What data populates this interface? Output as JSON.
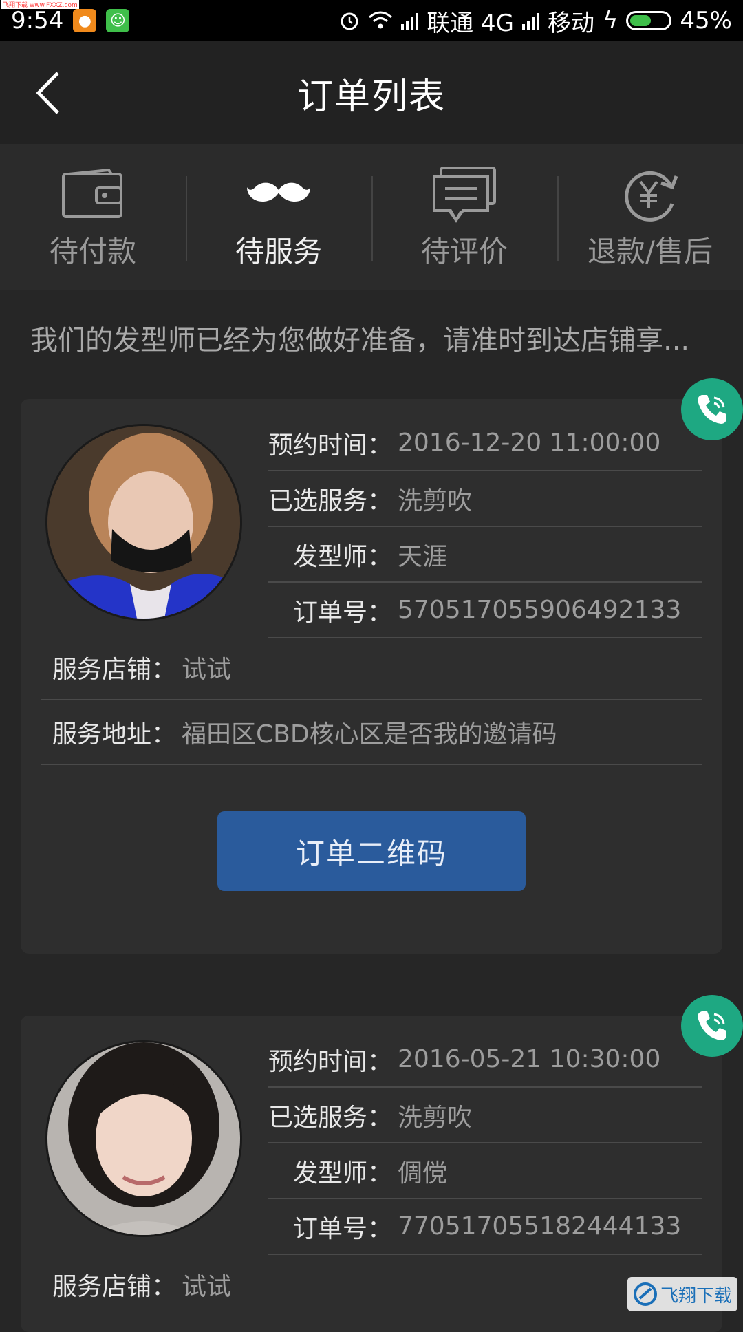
{
  "status_bar": {
    "time": "9:54",
    "carrier1": "联通 4G",
    "carrier2": "移动",
    "battery": "45%",
    "battery_level": 0.45,
    "top_watermark": "飞翔下载 www.FXXZ.com"
  },
  "header": {
    "title": "订单列表"
  },
  "tabs": [
    {
      "label": "待付款",
      "icon": "wallet-icon",
      "active": false
    },
    {
      "label": "待服务",
      "icon": "mustache-icon",
      "active": true
    },
    {
      "label": "待评价",
      "icon": "chat-icon",
      "active": false
    },
    {
      "label": "退款/售后",
      "icon": "yuan-refund-icon",
      "active": false
    }
  ],
  "notice": "我们的发型师已经为您做好准备，请准时到达店铺享...",
  "orders": [
    {
      "time_label": "预约时间：",
      "time_value": "2016-12-20 11:00:00",
      "service_label": "已选服务：",
      "service_value": "洗剪吹",
      "stylist_label": "发型师：",
      "stylist_value": "天涯",
      "order_no_label": "订单号：",
      "order_no_value": "570517055906492133",
      "store_label": "服务店铺：",
      "store_value": "试试",
      "address_label": "服务地址：",
      "address_value": "福田区CBD核心区是否我的邀请码",
      "qr_button": "订单二维码"
    },
    {
      "time_label": "预约时间：",
      "time_value": "2016-05-21 10:30:00",
      "service_label": "已选服务：",
      "service_value": "洗剪吹",
      "stylist_label": "发型师：",
      "stylist_value": "倜傥",
      "order_no_label": "订单号：",
      "order_no_value": "770517055182444133",
      "store_label": "服务店铺：",
      "store_value": "试试"
    }
  ],
  "bottom_watermark": "飞翔下载"
}
